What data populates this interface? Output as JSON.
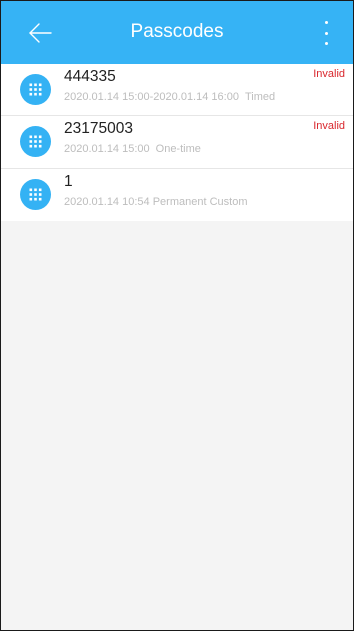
{
  "colors": {
    "header": "#36b3f5",
    "accent": "#34b2f4",
    "invalid": "#d9262c"
  },
  "header": {
    "title": "Passcodes",
    "back_icon": "arrow-left-icon",
    "menu_icon": "more-vertical-icon"
  },
  "passcodes": [
    {
      "code": "444335",
      "time": "2020.01.14 15:00-2020.01.14 16:00",
      "type": "Timed",
      "extra": "",
      "status": "Invalid",
      "icon": "keypad-icon"
    },
    {
      "code": "23175003",
      "time": "2020.01.14 15:00",
      "type": "One-time",
      "extra": "",
      "status": "Invalid",
      "icon": "keypad-icon"
    },
    {
      "code": "1",
      "time": "2020.01.14 10:54",
      "type": "Permanent",
      "extra": "Custom",
      "status": "",
      "icon": "keypad-icon"
    }
  ]
}
